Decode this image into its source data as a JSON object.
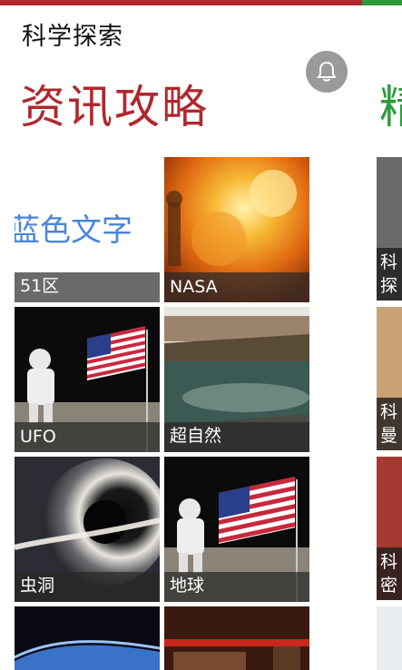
{
  "app": {
    "title": "科学探索"
  },
  "section": {
    "title": "资讯攻略",
    "next_title": "精"
  },
  "tiles": [
    {
      "label": "51区",
      "image": "blue-text-graphic",
      "image_text": "蓝色文字"
    },
    {
      "label": "NASA",
      "image": "explosion-photo"
    },
    {
      "label": "UFO",
      "image": "astronaut-flag-photo"
    },
    {
      "label": "超自然",
      "image": "river-landscape-photo"
    },
    {
      "label": "虫洞",
      "image": "black-hole-photo"
    },
    {
      "label": "地球",
      "image": "astronaut-flag-photo"
    }
  ],
  "side_items": [
    {
      "line1": "科",
      "line2": "探"
    },
    {
      "line1": "科",
      "line2": "曼"
    },
    {
      "line1": "科",
      "line2": "密"
    }
  ],
  "colors": {
    "accent": "#b0282e",
    "next_accent": "#2e9a3c"
  }
}
